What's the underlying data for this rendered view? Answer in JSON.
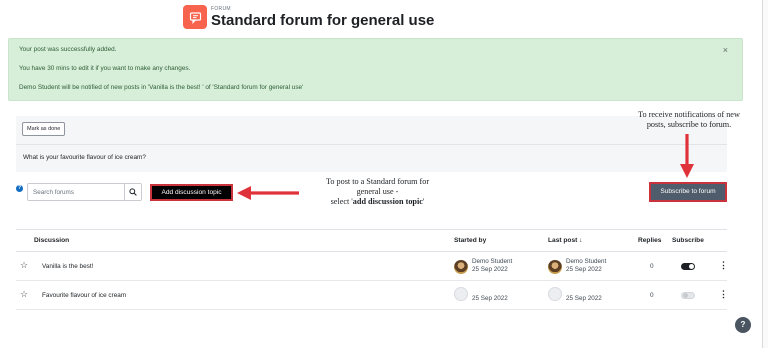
{
  "header": {
    "label": "FORUM",
    "title": "Standard forum for general use",
    "icon": "forum-icon",
    "icon_color": "#f7634d"
  },
  "alert": {
    "messages": [
      "Your post was successfully added.",
      "You have 30 mins to edit it if you want to make any changes.",
      "Demo Student will be notified of new posts in 'Vanilla is the best! ' of 'Standard forum for general use'"
    ],
    "close_icon": "close-icon",
    "close_label": "×"
  },
  "activity": {
    "mark_done_label": "Mark as done",
    "question": "What is your favourite flavour of ice cream?"
  },
  "toolbar": {
    "help_label": "?",
    "search_placeholder": "Search forums",
    "search_icon": "search-icon",
    "add_topic_label": "Add discussion topic",
    "subscribe_label": "Subscribe to forum"
  },
  "annotations": {
    "left_line1": "To post to a Standard forum for",
    "left_line2": "general use -",
    "left_line3_prefix": "select '",
    "left_line3_bold": "add discussion topic",
    "left_line3_suffix": "'",
    "right_line1": "To receive notifications of new",
    "right_line2": "posts, subscribe to forum.",
    "arrow_color": "#e0323a"
  },
  "table": {
    "headers": {
      "discussion": "Discussion",
      "started_by": "Started by",
      "last_post": "Last post ↓",
      "replies": "Replies",
      "subscribe": "Subscribe"
    },
    "rows": [
      {
        "topic": "Vanilla is the best!",
        "started_by_name": "Demo Student",
        "started_by_date": "25 Sep 2022",
        "last_post_name": "Demo Student",
        "last_post_date": "25 Sep 2022",
        "replies": "0",
        "subscribed": true
      },
      {
        "topic": "Favourite flavour of ice cream",
        "started_by_name": "",
        "started_by_date": "25 Sep 2022",
        "last_post_name": "",
        "last_post_date": "25 Sep 2022",
        "replies": "0",
        "subscribed": false
      }
    ]
  },
  "help_float_label": "?"
}
